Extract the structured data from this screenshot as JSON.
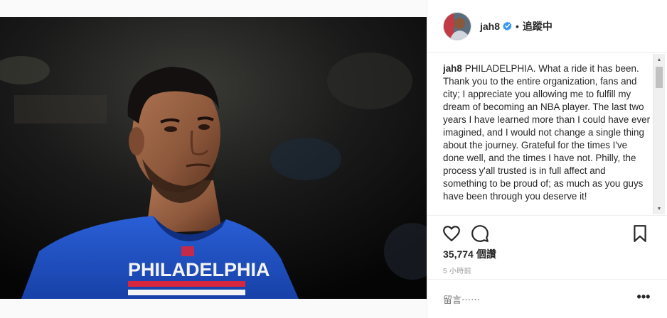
{
  "post": {
    "username": "jah8",
    "follow_status": "追蹤中",
    "dot_separator": "•",
    "caption_user": "jah8",
    "caption_text": "PHILADELPHIA. What a ride it has been. Thank you to the entire organization, fans and city; I appreciate you allowing me to fulfill my dream of becoming an NBA player. The last two years I have learned more than I could have ever imagined, and I would not change a single thing about the journey. Grateful for the times I've done well, and the times I have not. Philly, the process y'all trusted is in full affect and something to be proud of; as much as you guys have been through you deserve it!",
    "likes": "35,774 個讚",
    "timestamp": "5 小時前",
    "comment_placeholder": "留言⋯⋯",
    "more_label": "•••"
  },
  "photo": {
    "jersey_text": "PHILADELPHIA"
  },
  "icons": {
    "verified": "verified-badge-icon",
    "like": "heart-icon",
    "comment": "speech-bubble-icon",
    "save": "bookmark-icon"
  },
  "colors": {
    "verified_blue": "#3897f0",
    "jersey_blue": "#1d4fc4",
    "text": "#262626",
    "muted": "#999999"
  }
}
